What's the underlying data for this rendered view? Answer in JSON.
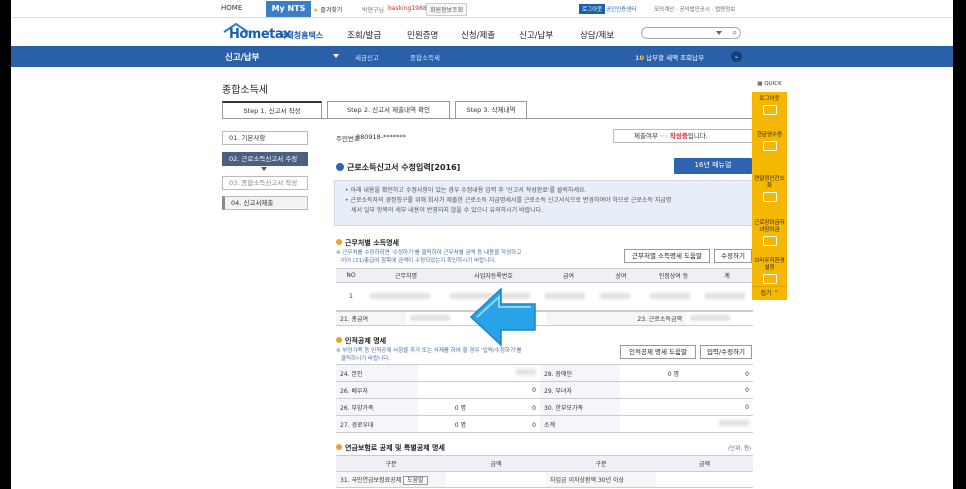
{
  "topbar": {
    "home": "HOME",
    "mynts": "My NTS",
    "favorites": "즐겨찾기",
    "user_label": "박현구님",
    "user_id": "basking1988...",
    "member_info": "회원정보조회",
    "logout": "로그아웃",
    "cert_center": "공인인증센터",
    "util_links": "모의계산 · 공익법인공시 · 법령정보"
  },
  "header": {
    "logo_text": "Hometax",
    "logo_sub": "국세청홈택스",
    "nav": [
      "조회/발급",
      "민원증명",
      "신청/제출",
      "신고/납부",
      "상담/제보"
    ]
  },
  "band": {
    "section": "신고/납부",
    "breadcrumb1": "세금신고",
    "breadcrumb2": "종합소득세",
    "notice_num": "10",
    "notice_text": "납부할 세액 조회납부"
  },
  "page": {
    "title": "종합소득세",
    "tabs": [
      "Step 1. 신고서 작성",
      "Step 2. 신고서 제출내역 확인",
      "Step 3. 삭제내역"
    ],
    "steps": [
      "01. 기본사항",
      "02. 근로소득신고서 수정",
      "03. 종합소득신고서 작성",
      "04. 신고서제출"
    ],
    "resident_label": "주민번호",
    "resident_value": "880918-*******",
    "submit_status_label": "제출여부",
    "submit_status_arrows": "›››",
    "submit_status_value": "작성중",
    "submit_status_suffix": "입니다.",
    "form_title": "근로소득신고서 수정입력[2016]",
    "manual_button": "16년 매뉴얼",
    "info_lines": [
      "아래 내용을 확인하고 수정사항이 있는 경우 수정내용 입력 후 '신고서 작성완료'를 클릭하세요.",
      "근로소득자의 경정청구를 위해 회사가 제출한 근로소득 지급명세서를 근로소득 신고서식으로 변경하여야 하므로 근로소득 지급명",
      "세서 일부 항목의 세부 내용이 반영되지 않을 수 있으니 유의하시기 바랍니다."
    ]
  },
  "workplace": {
    "title": "근무처별 소득명세",
    "notes": [
      "※ 근무처를 수정하려면 '수정하기'를 클릭하여 근무처별 금액 등 내용을 작성하고",
      "이어 (21)총급여 항목에 금액이 수정되었는지 확인하시기 바랍니다."
    ],
    "help_button": "근무처별 소득명세 도움말",
    "edit_button": "수정하기",
    "columns": [
      "NO",
      "근무처명",
      "사업자등록번호",
      "급여",
      "상여",
      "인정상여 등",
      "계"
    ],
    "row_no": "1",
    "total_label": "21. 총급여",
    "earned_label": "23. 근로소득금액"
  },
  "personal": {
    "title": "인적공제 명세",
    "notes": [
      "※ 부양가족 등 인적공제 사항을 추가 또는 삭제를 하여 할 경우 '입력/수정하기'를",
      "클릭하시기 바랍니다."
    ],
    "help_button": "인적공제 명세 도움말",
    "edit_button": "입력/수정하기",
    "rows": [
      {
        "left": "24. 본인",
        "left_count": "",
        "left_val": "",
        "right": "28. 장애인",
        "right_count": "0",
        "right_val": "0"
      },
      {
        "left": "26. 배우자",
        "left_count": "",
        "left_val": "0",
        "right": "29. 부녀자",
        "right_count": "",
        "right_val": "0"
      },
      {
        "left": "26. 부양가족",
        "left_count": "0",
        "left_val": "0",
        "right": "30. 한부모가족",
        "right_count": "",
        "right_val": "0"
      },
      {
        "left": "27. 경로우대",
        "left_count": "0",
        "left_val": "0",
        "right": "소계",
        "right_count": "",
        "right_val": ""
      }
    ],
    "unit_person": "명"
  },
  "pension": {
    "title": "연금보험료 공제 및 특별공제 명세",
    "unit": "(단위: 원)",
    "columns": [
      "구분",
      "금액",
      "구분",
      "금액"
    ],
    "row_left": "31. 국민연금보험료공제",
    "row_btn": "도움말",
    "row_right": "차입금 이자상환액 30년 이상"
  },
  "quick": {
    "head": "QUICK",
    "items": [
      "로그아웃",
      "현금영수증",
      "연말정산간소화",
      "근로장려금자녀장려금",
      "브라우저환경설정"
    ],
    "foot": "접기"
  }
}
